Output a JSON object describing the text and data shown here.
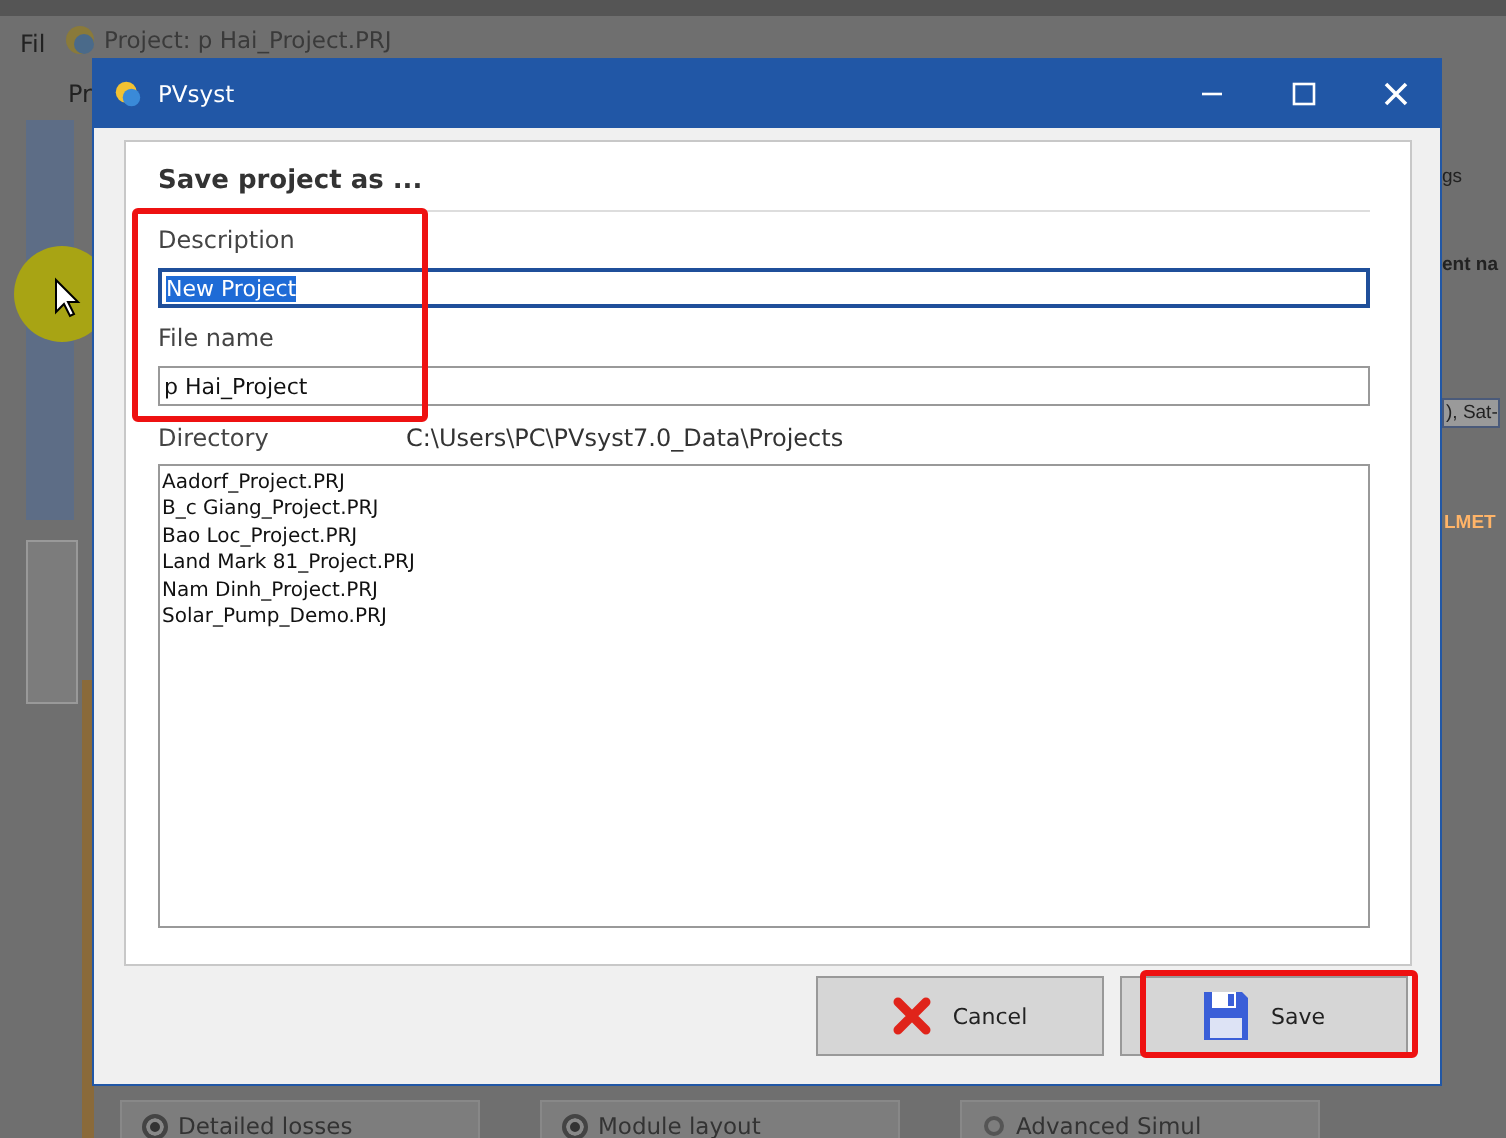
{
  "background_window": {
    "menu": "Fil",
    "title": "Project:  p Hai_Project.PRJ",
    "tab": "Pr",
    "fragments": [
      {
        "text": "gs",
        "kind": "plain"
      },
      {
        "text": "ent na",
        "kind": "bold"
      },
      {
        "text": "), Sat-",
        "kind": "field"
      },
      {
        "text": "LMET",
        "kind": "warning"
      }
    ],
    "buttons": [
      {
        "label": "Detailed losses",
        "kind": "radio",
        "checked": true
      },
      {
        "label": "Module layout",
        "kind": "radio",
        "checked": true
      },
      {
        "label": "Advanced Simul",
        "kind": "tool"
      }
    ]
  },
  "dialog": {
    "title": "PVsyst",
    "heading": "Save project as ...",
    "fields": [
      {
        "label": "Description",
        "value": "New Project",
        "selected": true
      },
      {
        "label": "File name",
        "value": "p Hai_Project",
        "selected": false
      }
    ],
    "fields_highlighted": true,
    "directory": {
      "label": "Directory",
      "path": "C:\\Users\\PC\\PVsyst7.0_Data\\Projects"
    },
    "files": [
      "Aadorf_Project.PRJ",
      "B_c Giang_Project.PRJ",
      "Bao Loc_Project.PRJ",
      "Land Mark 81_Project.PRJ",
      "Nam Dinh_Project.PRJ",
      "Solar_Pump_Demo.PRJ"
    ],
    "buttons": [
      {
        "label": "Cancel",
        "kind": "cancel",
        "highlighted": false
      },
      {
        "label": "Save",
        "kind": "save",
        "highlighted": true
      }
    ]
  }
}
